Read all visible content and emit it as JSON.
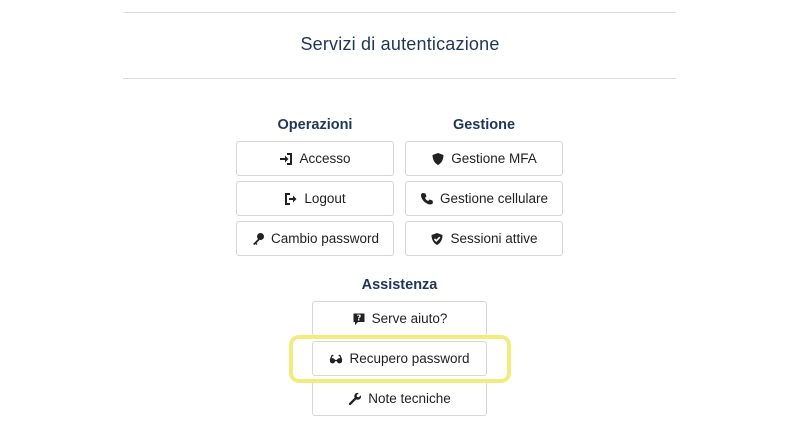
{
  "page_title": "Servizi di autenticazione",
  "sections": {
    "operazioni": {
      "title": "Operazioni",
      "buttons": [
        {
          "label": "Accesso",
          "icon": "sign-in-icon"
        },
        {
          "label": "Logout",
          "icon": "sign-out-icon"
        },
        {
          "label": "Cambio password",
          "icon": "key-icon"
        }
      ]
    },
    "gestione": {
      "title": "Gestione",
      "buttons": [
        {
          "label": "Gestione MFA",
          "icon": "shield-icon"
        },
        {
          "label": "Gestione cellulare",
          "icon": "phone-icon"
        },
        {
          "label": "Sessioni attive",
          "icon": "shield-check-icon"
        }
      ]
    },
    "assistenza": {
      "title": "Assistenza",
      "buttons": [
        {
          "label": "Serve aiuto?",
          "icon": "question-comment-icon"
        },
        {
          "label": "Recupero password",
          "icon": "glasses-icon"
        },
        {
          "label": "Note tecniche",
          "icon": "wrench-icon"
        }
      ]
    }
  },
  "colors": {
    "heading": "#1f3658",
    "border": "#d6d6d6",
    "highlight": "#f2ec7f"
  }
}
